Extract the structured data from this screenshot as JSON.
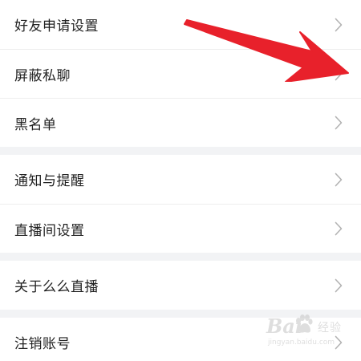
{
  "settings": {
    "group1": [
      {
        "label": "好友申请设置",
        "icon": "chevron-right-icon"
      },
      {
        "label": "屏蔽私聊",
        "icon": "chevron-right-icon"
      },
      {
        "label": "黑名单",
        "icon": "chevron-right-icon"
      }
    ],
    "group2": [
      {
        "label": "通知与提醒",
        "icon": "chevron-right-icon"
      },
      {
        "label": "直播间设置",
        "icon": "chevron-right-icon"
      }
    ],
    "group3": [
      {
        "label": "关于么么直播",
        "icon": "chevron-right-icon"
      }
    ],
    "group4": [
      {
        "label": "注销账号",
        "icon": "chevron-right-icon"
      }
    ]
  },
  "annotation": {
    "arrow_color": "#e8212b"
  },
  "watermark": {
    "brand": "Bai",
    "cn": "经验",
    "url": "jingyan.baidu.com"
  },
  "colors": {
    "background": "#f2f3f5",
    "row_background": "#ffffff",
    "text": "#222222",
    "chevron": "#b3b3b3",
    "divider": "#eeeeee"
  }
}
